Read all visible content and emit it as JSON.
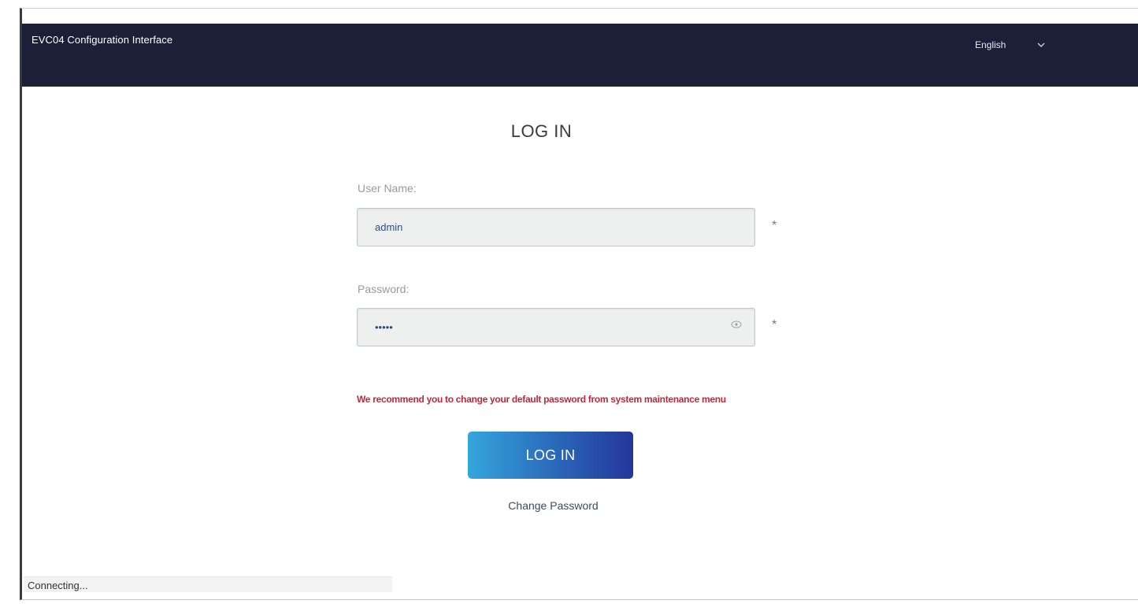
{
  "header": {
    "app_title": "EVC04 Configuration Interface",
    "language": "English"
  },
  "login": {
    "title": "LOG IN",
    "username_label": "User Name:",
    "username_value": "admin",
    "password_label": "Password:",
    "password_value": "•••••",
    "required_marker": "*",
    "warning": "We recommend you to change your default password from system maintenance menu",
    "button_label": "LOG IN",
    "change_password_label": "Change Password"
  },
  "status_bar": {
    "text": "Connecting..."
  },
  "icons": {
    "language_dropdown": "chevron-down-icon",
    "password_toggle": "eye-icon"
  },
  "colors": {
    "header_bg": "#1c1f38",
    "warning": "#c0273a",
    "button_gradient_start": "#35a6dd",
    "button_gradient_end": "#24369a"
  }
}
